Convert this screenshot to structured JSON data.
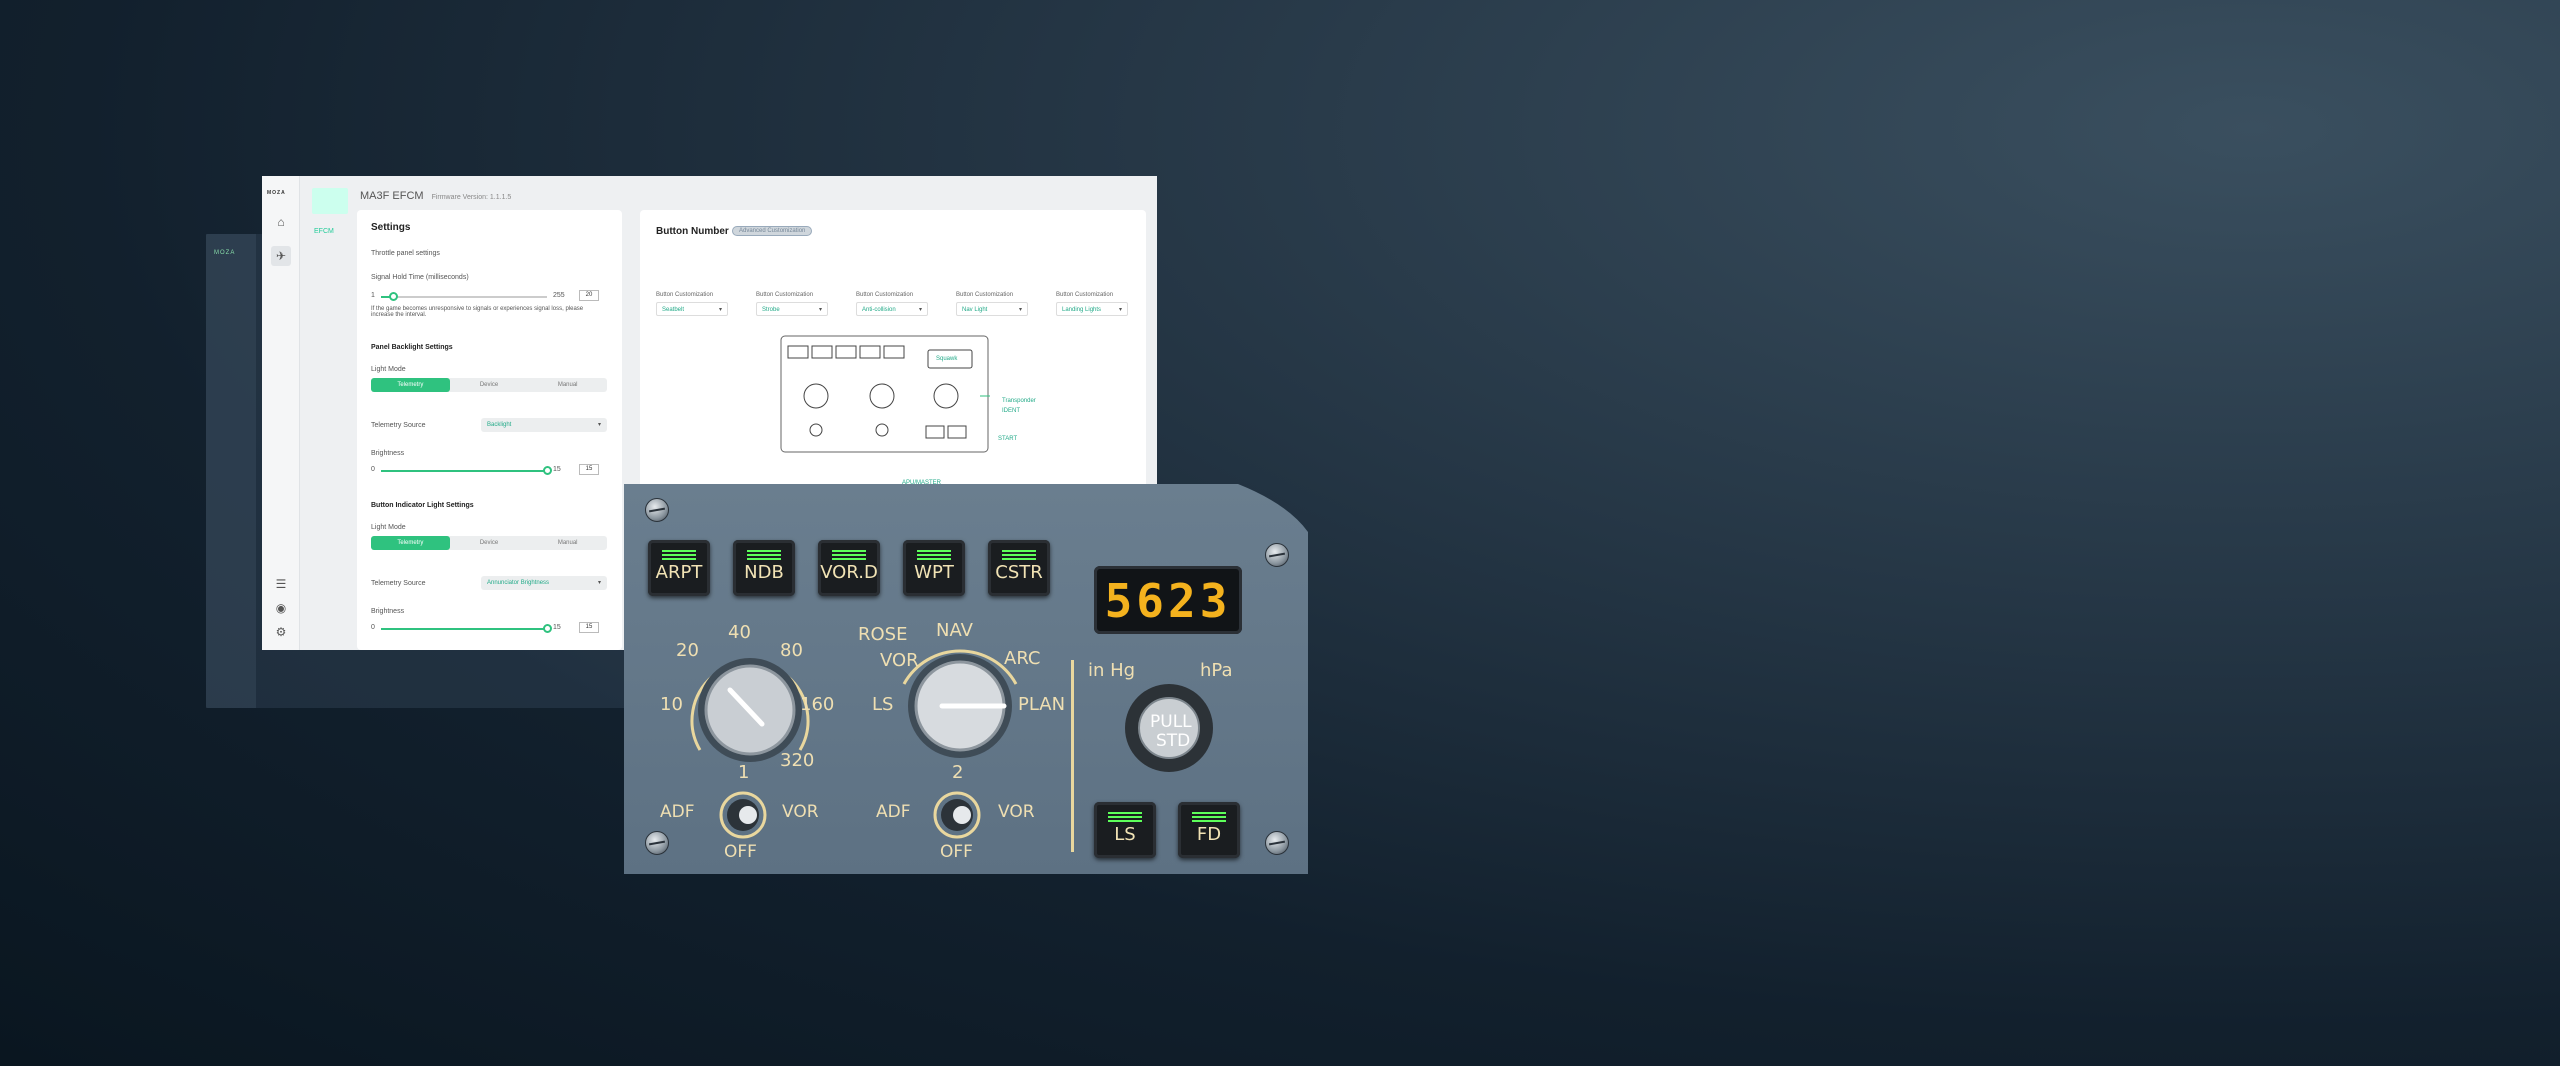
{
  "app": {
    "logo": "MOZA",
    "title": "MA3F EFCM",
    "firmware": "Firmware Version: 1.1.1.5",
    "device_label": "EFCM"
  },
  "settings": {
    "title": "Settings",
    "throttle": "Throttle panel settings",
    "hold_label": "Signal Hold Time (milliseconds)",
    "hold_min": "1",
    "hold_max": "255",
    "hold_value": "20",
    "hold_note": "If the game becomes unresponsive to signals or experiences signal loss, please increase the interval.",
    "backlight_title": "Panel Backlight Settings",
    "light_mode": "Light Mode",
    "modes": [
      "Telemetry",
      "Device",
      "Manual"
    ],
    "telemetry_source": "Telemetry Source",
    "backlight_source": "Backlight",
    "brightness": "Brightness",
    "b_min": "0",
    "b_max": "15",
    "b_value": "15",
    "indicator_title": "Button Indicator Light Settings",
    "indicator_source": "Annunciator Brightness",
    "b2_value": "15"
  },
  "buttons": {
    "title": "Button Number",
    "pill": "Advanced Customization",
    "custom_label": "Button Customization",
    "options": [
      "Seatbelt",
      "Strobe",
      "Anti-collision",
      "Nav Light",
      "Landing Lights"
    ],
    "dropdown_value": "Squawk",
    "transponder": "Transponder",
    "ident": "IDENT",
    "start": "START",
    "autostart": "APU/MASTER"
  },
  "panel": {
    "buttons": [
      "ARPT",
      "NDB",
      "VOR.D",
      "WPT",
      "CSTR"
    ],
    "display": "5623",
    "range_labels": [
      "10",
      "20",
      "40",
      "80",
      "160",
      "320"
    ],
    "mode_labels": [
      "LS",
      "VOR",
      "ROSE",
      "NAV",
      "ARC",
      "PLAN"
    ],
    "nav1": [
      "1",
      "ADF",
      "VOR",
      "OFF"
    ],
    "nav2": [
      "2",
      "ADF",
      "VOR",
      "OFF"
    ],
    "baro": [
      "in Hg",
      "hPa"
    ],
    "pull_std": [
      "PULL",
      "STD"
    ],
    "bottom_buttons": [
      "LS",
      "FD"
    ],
    "accent": "#5dff5a",
    "display_color": "#f4b21e"
  }
}
